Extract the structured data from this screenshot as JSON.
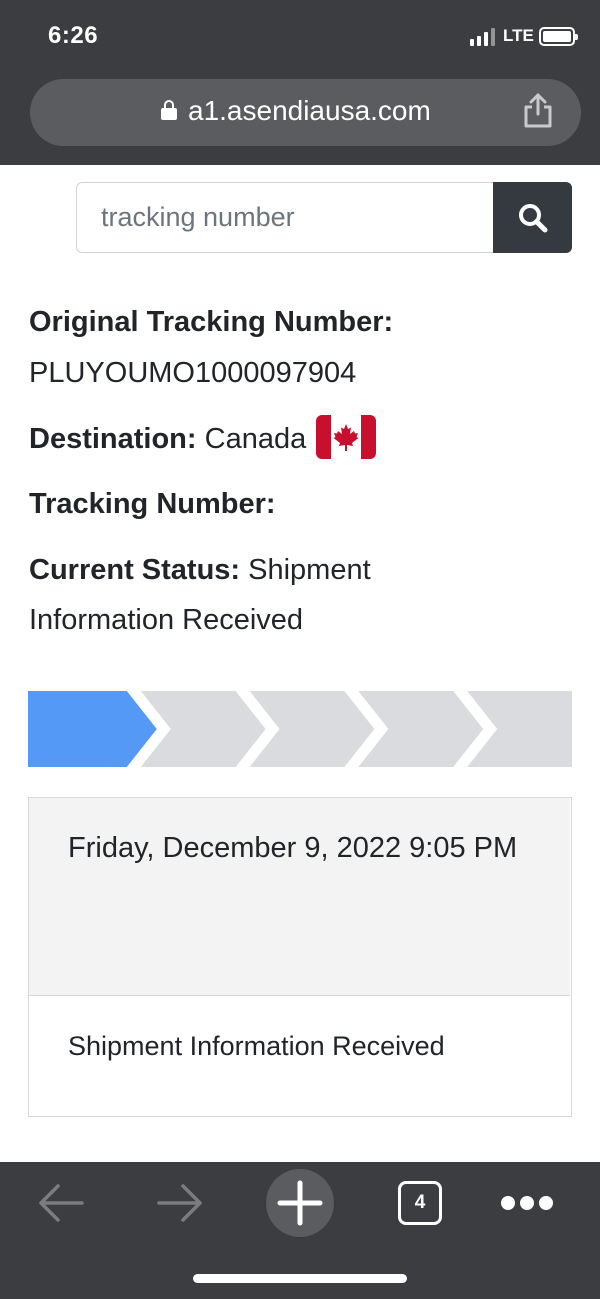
{
  "status_bar": {
    "time": "6:26",
    "network": "LTE"
  },
  "browser": {
    "url": "a1.asendiausa.com",
    "tab_count": "4"
  },
  "search": {
    "placeholder": "tracking number"
  },
  "shipment": {
    "original_tracking_label": "Original Tracking Number:",
    "original_tracking_value": "PLUYOUMO1000097904",
    "destination_label": "Destination:",
    "destination_value": "Canada",
    "destination_flag_icon": "canada-flag-icon",
    "tracking_label": "Tracking Number:",
    "tracking_value": "",
    "status_label": "Current Status:",
    "status_value": "Shipment Information Received"
  },
  "progress": {
    "total_steps": 5,
    "completed_steps": 1,
    "active_color": "#5599f7",
    "inactive_color": "#d9dbde"
  },
  "events": [
    {
      "date": "Friday, December 9, 2022 9:05 PM",
      "description": "Shipment Information Received"
    }
  ],
  "colors": {
    "chrome": "#3b3d40",
    "search_button": "#343a40"
  }
}
